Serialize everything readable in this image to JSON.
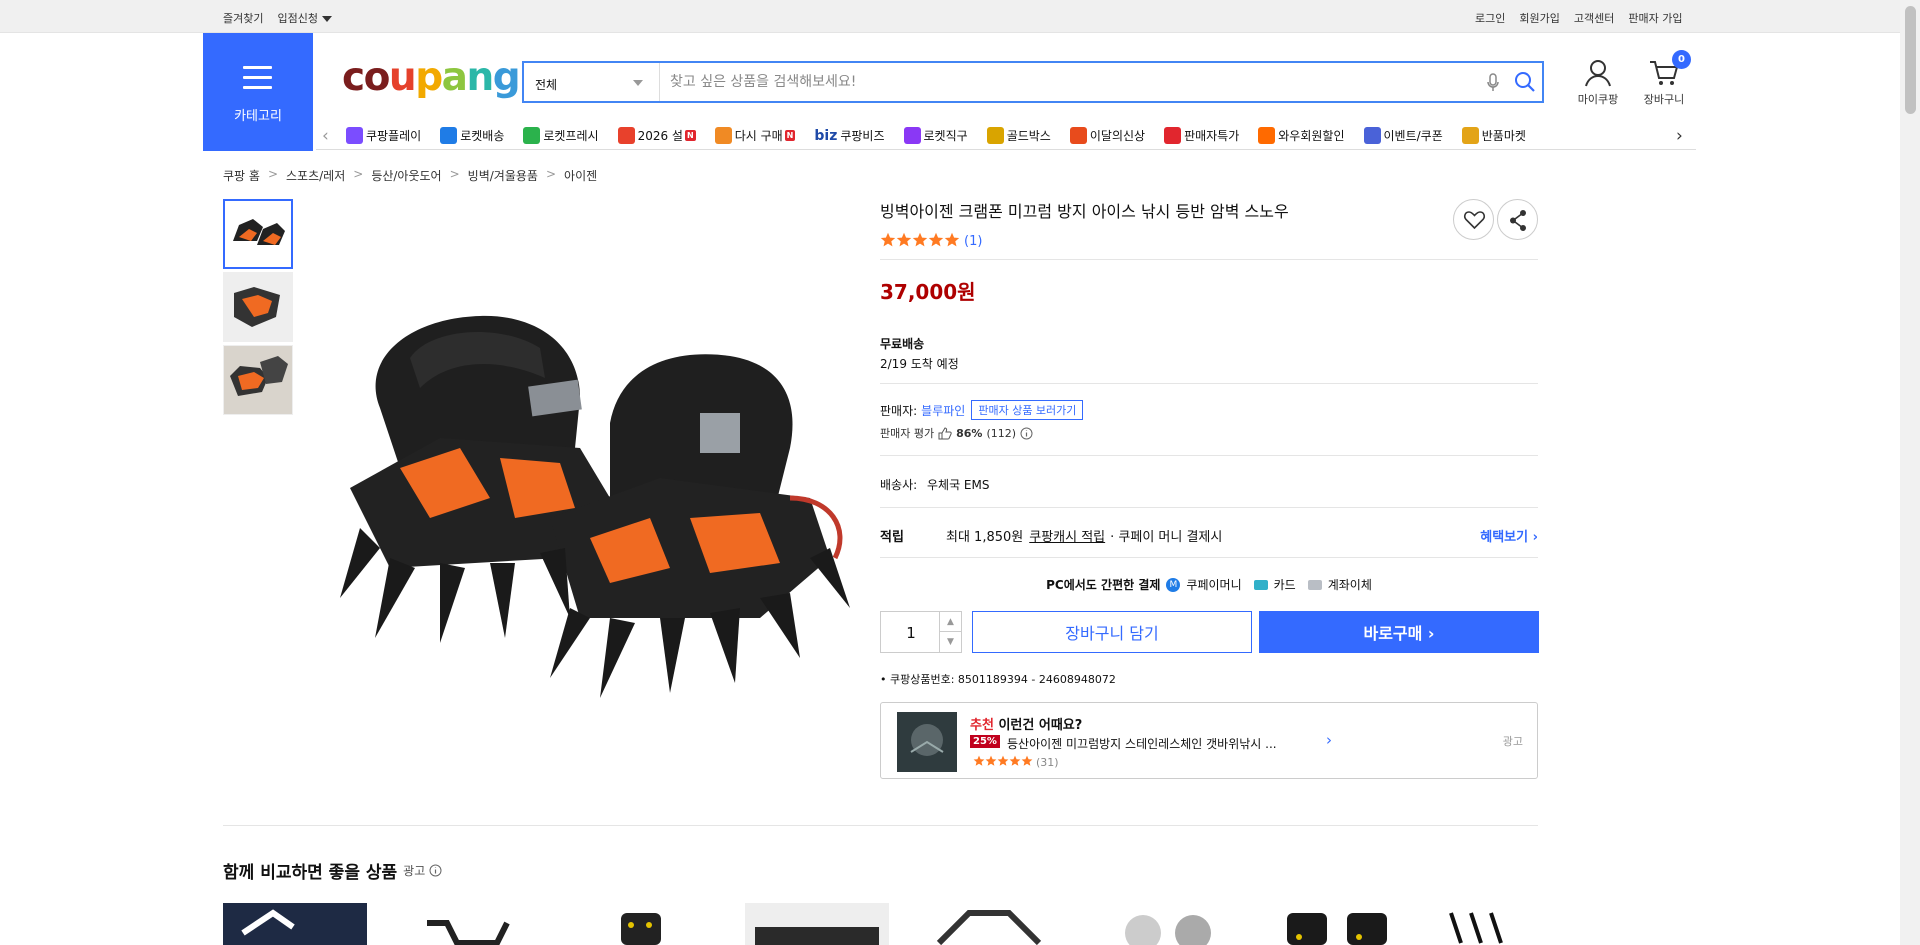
{
  "topbar": {
    "bookmark": "즐겨찾기",
    "entry": "입점신청",
    "login": "로그인",
    "signup": "회원가입",
    "support": "고객센터",
    "seller_signup": "판매자 가입"
  },
  "header": {
    "category_label": "카테고리",
    "logo": {
      "c": "c",
      "o": "o",
      "u": "u",
      "p": "p",
      "a": "a",
      "n": "n",
      "g": "g"
    },
    "search": {
      "category": "전체",
      "placeholder": "찾고 싶은 상품을 검색해보세요!"
    },
    "mycoupang": "마이쿠팡",
    "cart_label": "장바구니",
    "cart_count": "0"
  },
  "quicklinks": [
    {
      "label": "쿠팡플레이",
      "color": "#7b4dff"
    },
    {
      "label": "로켓배송",
      "color": "#1f7ce6"
    },
    {
      "label": "로켓프레시",
      "color": "#2bb24c"
    },
    {
      "label": "2026 설",
      "color": "#e8412c",
      "new": "N"
    },
    {
      "label": "다시 구매",
      "color": "#f08a24",
      "new": "N"
    },
    {
      "label": "쿠팡비즈",
      "color": "#1f4aa8"
    },
    {
      "label": "로켓직구",
      "color": "#8a38f5"
    },
    {
      "label": "골드박스",
      "color": "#d9a400"
    },
    {
      "label": "이달의신상",
      "color": "#e84b1c"
    },
    {
      "label": "판매자특가",
      "color": "#e1262e"
    },
    {
      "label": "와우회원할인",
      "color": "#ff6a00"
    },
    {
      "label": "이벤트/쿠폰",
      "color": "#4a62d8"
    },
    {
      "label": "반품마켓",
      "color": "#e3a418"
    }
  ],
  "quick_biz": "biz",
  "breadcrumb": [
    "쿠팡 홈",
    "스포츠/레저",
    "등산/아웃도어",
    "빙벽/겨울용품",
    "아이젠"
  ],
  "product": {
    "title": "빙벽아이젠 크램폰 미끄럼 방지 아이스 낚시 등반 암벽 스노우",
    "rating": 5,
    "review_count": "(1)",
    "price": "37,000원",
    "shipping_type": "무료배송",
    "eta": "2/19 도착 예정",
    "seller_label": "판매자:",
    "seller_name": "블루파인",
    "seller_link": "판매자 상품 보러가기",
    "seller_rating_label": "판매자 평가",
    "seller_rating_pct": "86%",
    "seller_rating_count": "(112)",
    "shipper_label": "배송사:",
    "shipper": "우체국 EMS",
    "points_label": "적립",
    "points_text": "최대 1,850원",
    "points_link": "쿠팡캐시 적립",
    "points_suffix": "· 쿠페이 머니 결제시",
    "benefits": "혜택보기",
    "pay_title": "PC에서도 간편한 결제",
    "pay_methods": [
      "쿠페이머니",
      "카드",
      "계좌이체"
    ],
    "quantity": "1",
    "add_cart": "장바구니 담기",
    "buy_now": "바로구매",
    "product_no": "쿠팡상품번호: 8501189394 - 24608948072"
  },
  "recommendation": {
    "prefix": "추천",
    "title": "이런건 어때요?",
    "discount": "25%",
    "name": "등산아이젠 미끄럼방지 스테인레스체인 갯바위낚시 ...",
    "rating": 5,
    "count": "(31)",
    "ad": "광고"
  },
  "compare": {
    "title": "함께 비교하면 좋을 상품",
    "ad": "광고"
  },
  "colors": {
    "accent": "#346aff",
    "price": "#ae0000",
    "star": "#ff7a22"
  }
}
